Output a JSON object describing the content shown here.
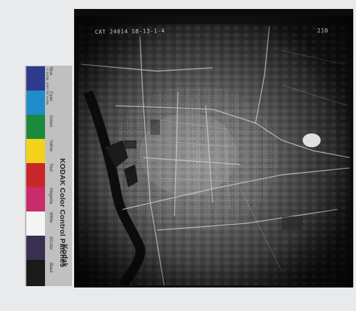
{
  "card": {
    "title": "KODAK Color Control Patches",
    "brand": "Kodak",
    "fine_print": "© Kodak, 2007 TM: Kodak",
    "patches": [
      {
        "label": "Blue",
        "color": "#2e3a8c"
      },
      {
        "label": "Cyan",
        "color": "#1f8ccc"
      },
      {
        "label": "Green",
        "color": "#1c8a3c"
      },
      {
        "label": "Yellow",
        "color": "#f2d21a"
      },
      {
        "label": "Red",
        "color": "#c9262b"
      },
      {
        "label": "Magenta",
        "color": "#c92c6a"
      },
      {
        "label": "White",
        "color": "#f4f4f4"
      },
      {
        "label": "3/Color",
        "color": "#3a3050"
      },
      {
        "label": "Black",
        "color": "#1a1a1a"
      }
    ]
  },
  "photo": {
    "annotations": {
      "reference_code": "CAT 24014 SB-13-1-4",
      "frame_number": "210"
    }
  },
  "colors": {
    "background": "#e9eaec",
    "photo_frame": "#121212",
    "card_gray": "#b9b9b9"
  }
}
